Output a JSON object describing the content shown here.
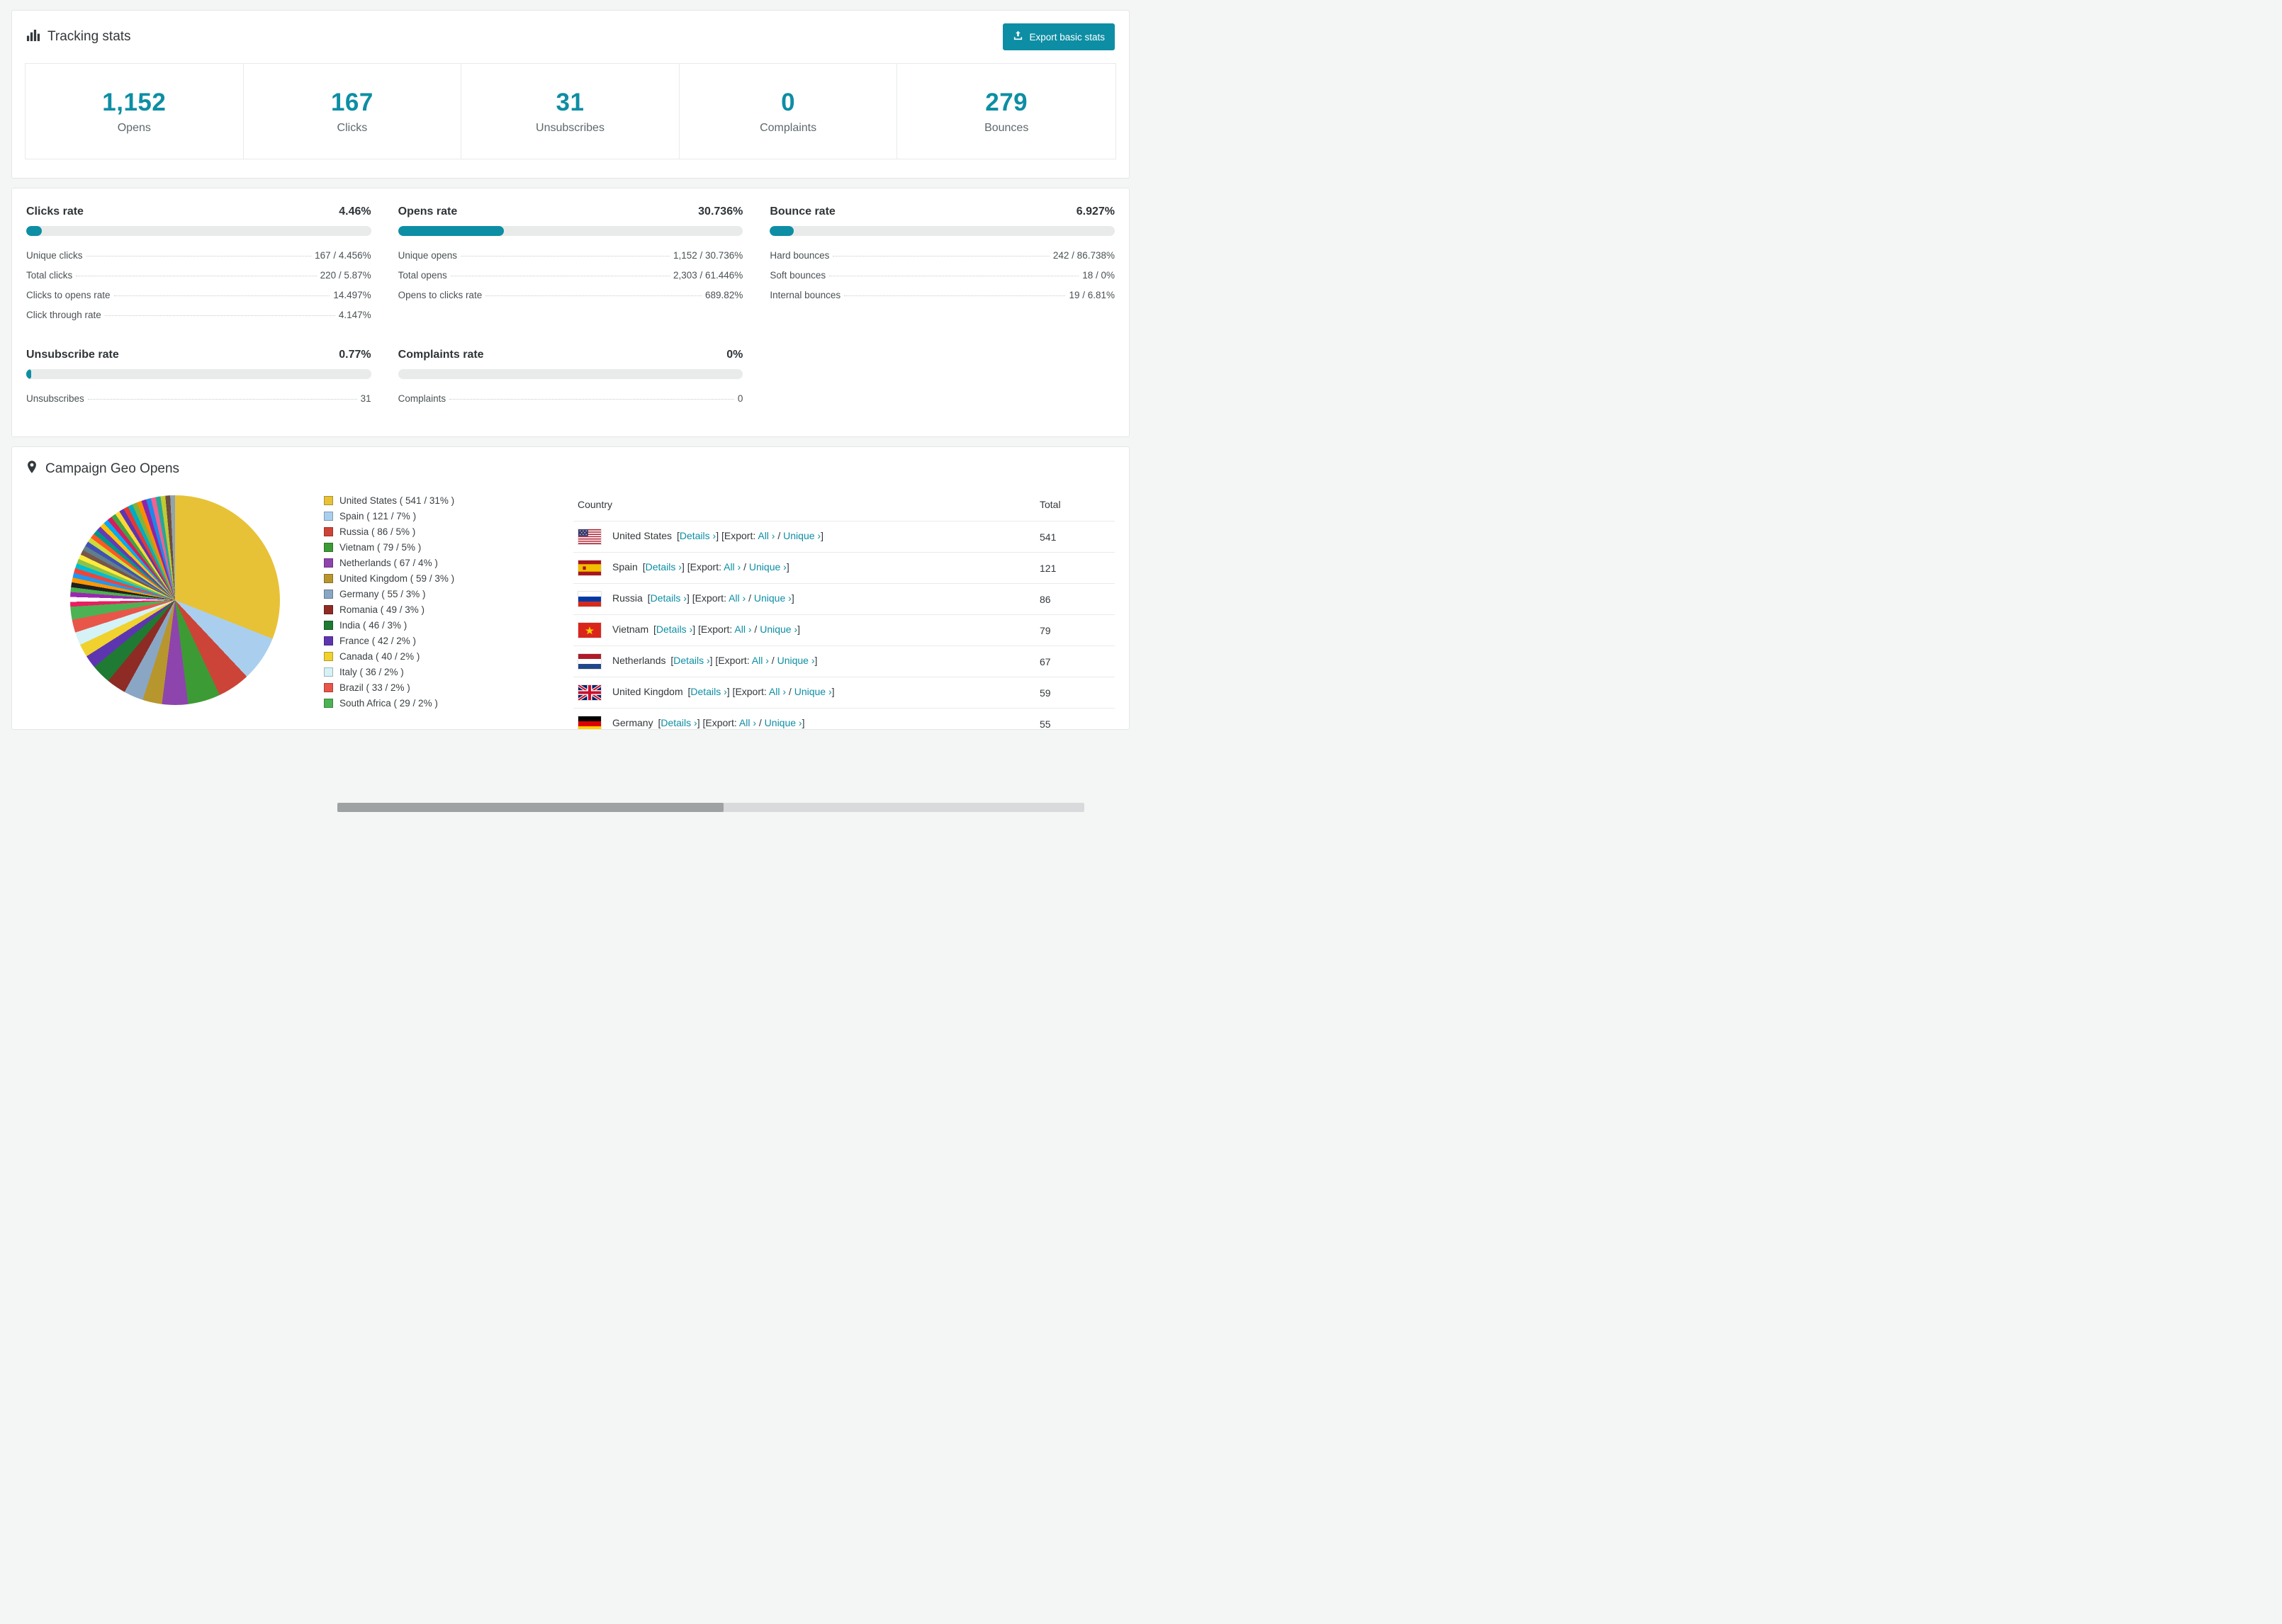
{
  "theme": {
    "accent": "#0d8ea4",
    "text": "#33383b",
    "muted": "#5f686c",
    "track": "#e9ebeb"
  },
  "tracking": {
    "title": "Tracking stats",
    "export_button": "Export basic stats",
    "stats": [
      {
        "value": "1,152",
        "label": "Opens"
      },
      {
        "value": "167",
        "label": "Clicks"
      },
      {
        "value": "31",
        "label": "Unsubscribes"
      },
      {
        "value": "0",
        "label": "Complaints"
      },
      {
        "value": "279",
        "label": "Bounces"
      }
    ]
  },
  "rates": [
    {
      "title": "Clicks rate",
      "value": "4.46%",
      "percent": 4.46,
      "rows": [
        {
          "label": "Unique clicks",
          "value": "167 / 4.456%"
        },
        {
          "label": "Total clicks",
          "value": "220 / 5.87%"
        },
        {
          "label": "Clicks to opens rate",
          "value": "14.497%"
        },
        {
          "label": "Click through rate",
          "value": "4.147%"
        }
      ]
    },
    {
      "title": "Opens rate",
      "value": "30.736%",
      "percent": 30.736,
      "rows": [
        {
          "label": "Unique opens",
          "value": "1,152 / 30.736%"
        },
        {
          "label": "Total opens",
          "value": "2,303 / 61.446%"
        },
        {
          "label": "Opens to clicks rate",
          "value": "689.82%"
        }
      ]
    },
    {
      "title": "Bounce rate",
      "value": "6.927%",
      "percent": 6.927,
      "rows": [
        {
          "label": "Hard bounces",
          "value": "242 / 86.738%"
        },
        {
          "label": "Soft bounces",
          "value": "18 / 0%"
        },
        {
          "label": "Internal bounces",
          "value": "19 / 6.81%"
        }
      ]
    },
    {
      "title": "Unsubscribe rate",
      "value": "0.77%",
      "percent": 0.77,
      "rows": [
        {
          "label": "Unsubscribes",
          "value": "31"
        }
      ]
    },
    {
      "title": "Complaints rate",
      "value": "0%",
      "percent": 0,
      "rows": [
        {
          "label": "Complaints",
          "value": "0"
        }
      ]
    }
  ],
  "geo": {
    "title": "Campaign Geo Opens",
    "table": {
      "headers": [
        "Country",
        "Total"
      ],
      "details_label": "Details",
      "export_label": "Export:",
      "all_label": "All",
      "unique_label": "Unique",
      "rows": [
        {
          "country": "United States",
          "total": "541",
          "flag": "us"
        },
        {
          "country": "Spain",
          "total": "121",
          "flag": "es"
        },
        {
          "country": "Russia",
          "total": "86",
          "flag": "ru"
        },
        {
          "country": "Vietnam",
          "total": "79",
          "flag": "vn"
        },
        {
          "country": "Netherlands",
          "total": "67",
          "flag": "nl"
        },
        {
          "country": "United Kingdom",
          "total": "59",
          "flag": "gb"
        },
        {
          "country": "Germany",
          "total": "55",
          "flag": "de"
        }
      ]
    }
  },
  "chart_data": {
    "type": "pie",
    "title": "Campaign Geo Opens",
    "legend_position": "right",
    "slices": [
      {
        "label": "United States",
        "value": 541,
        "pct": 31,
        "color": "#e7c236"
      },
      {
        "label": "Spain",
        "value": 121,
        "pct": 7,
        "color": "#aacfee"
      },
      {
        "label": "Russia",
        "value": 86,
        "pct": 5,
        "color": "#cc4437"
      },
      {
        "label": "Vietnam",
        "value": 79,
        "pct": 5,
        "color": "#3d9b35"
      },
      {
        "label": "Netherlands",
        "value": 67,
        "pct": 4,
        "color": "#8e44ad"
      },
      {
        "label": "United Kingdom",
        "value": 59,
        "pct": 3,
        "color": "#b8962e"
      },
      {
        "label": "Germany",
        "value": 55,
        "pct": 3,
        "color": "#8aa6c5"
      },
      {
        "label": "Romania",
        "value": 49,
        "pct": 3,
        "color": "#8e2b25"
      },
      {
        "label": "India",
        "value": 46,
        "pct": 3,
        "color": "#1f7a33"
      },
      {
        "label": "France",
        "value": 42,
        "pct": 2,
        "color": "#5e35b1"
      },
      {
        "label": "Canada",
        "value": 40,
        "pct": 2,
        "color": "#f0d12e"
      },
      {
        "label": "Italy",
        "value": 36,
        "pct": 2,
        "color": "#d5f2f6"
      },
      {
        "label": "Brazil",
        "value": 33,
        "pct": 2,
        "color": "#e8564a"
      },
      {
        "label": "South Africa",
        "value": 29,
        "pct": 2,
        "color": "#4db253"
      }
    ],
    "others_colors": [
      "#e91e63",
      "#ffffff",
      "#9c27b0",
      "#4caf50",
      "#212121",
      "#ff9800",
      "#2196f3",
      "#f44336",
      "#00bcd4",
      "#8bc34a",
      "#ffeb3b",
      "#795548",
      "#607d8b",
      "#3f51b5",
      "#cddc39",
      "#ff5722",
      "#009688",
      "#673ab7",
      "#ffc107",
      "#03a9f4",
      "#d81b60",
      "#43a047",
      "#fdd835",
      "#5e35b1",
      "#e53935",
      "#00acc1",
      "#7cb342",
      "#fb8c00",
      "#8e24aa",
      "#1e88e5",
      "#f06292",
      "#26a69a",
      "#c0ca33",
      "#6d4c41",
      "#90a4ae"
    ]
  }
}
